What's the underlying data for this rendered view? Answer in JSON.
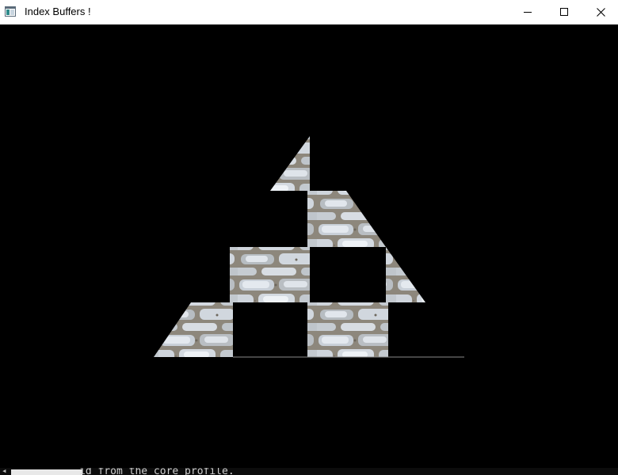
{
  "window": {
    "title": "Index Buffers !",
    "icon": "opengl-window-icon",
    "controls": {
      "minimize_icon": "minimize-icon",
      "maximize_icon": "maximize-icon",
      "close_icon": "close-icon"
    }
  },
  "scene": {
    "background_color": "#000000",
    "texture": "stone-brick",
    "texture_colors": [
      "#8d877c",
      "#d6dde6",
      "#6d675d"
    ]
  },
  "console": {
    "visible_text": "id from the core profile."
  }
}
